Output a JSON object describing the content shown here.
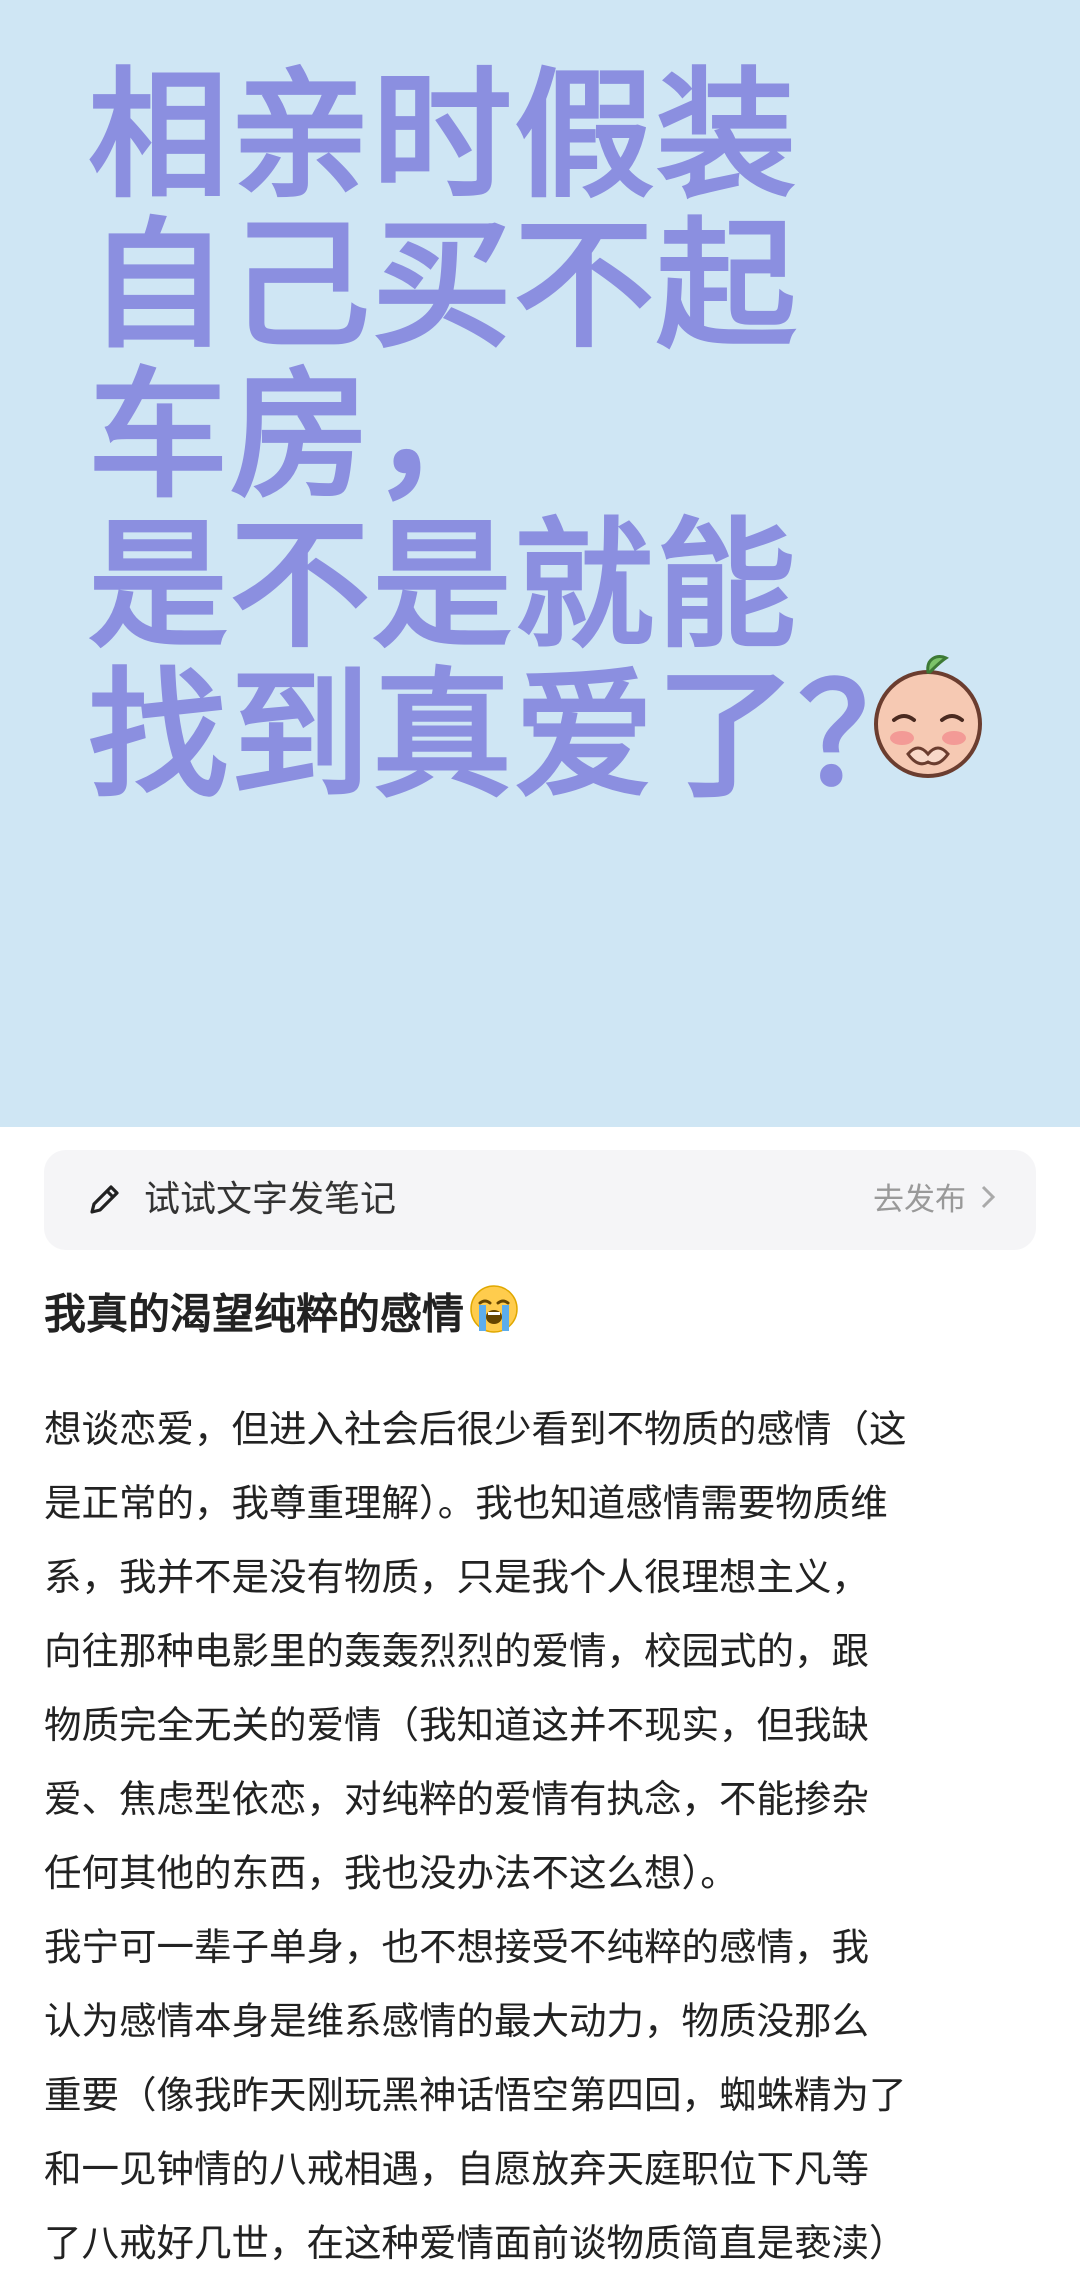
{
  "cover": {
    "lines": [
      "相亲时假装",
      "自己买不起",
      "车房，",
      "是不是就能",
      "找到真爱了？"
    ],
    "emoji": "shy-peach-emoji",
    "background_color": "#cfe6f4",
    "text_color": "#8b8fe0"
  },
  "composer": {
    "icon": "pencil-icon",
    "label": "试试文字发笔记",
    "publish_label": "去发布",
    "publish_icon": "chevron-right-icon"
  },
  "note": {
    "title": "我真的渴望纯粹的感情",
    "title_emoji": "loudly-crying-face-emoji",
    "body_lines": [
      "想谈恋爱，但进入社会后很少看到不物质的感情（这",
      "是正常的，我尊重理解）。我也知道感情需要物质维",
      "系，我并不是没有物质，只是我个人很理想主义，",
      "向往那种电影里的轰轰烈烈的爱情，校园式的，跟",
      "物质完全无关的爱情（我知道这并不现实，但我缺",
      "爱、焦虑型依恋，对纯粹的爱情有执念，不能掺杂",
      "任何其他的东西，我也没办法不这么想）。",
      "我宁可一辈子单身，也不想接受不纯粹的感情，我",
      "认为感情本身是维系感情的最大动力，物质没那么",
      "重要（像我昨天刚玩黑神话悟空第四回，蜘蛛精为了",
      "和一见钟情的八戒相遇，自愿放弃天庭职位下凡等",
      "了八戒好几世，在这种爱情面前谈物质简直是亵渎）"
    ]
  }
}
